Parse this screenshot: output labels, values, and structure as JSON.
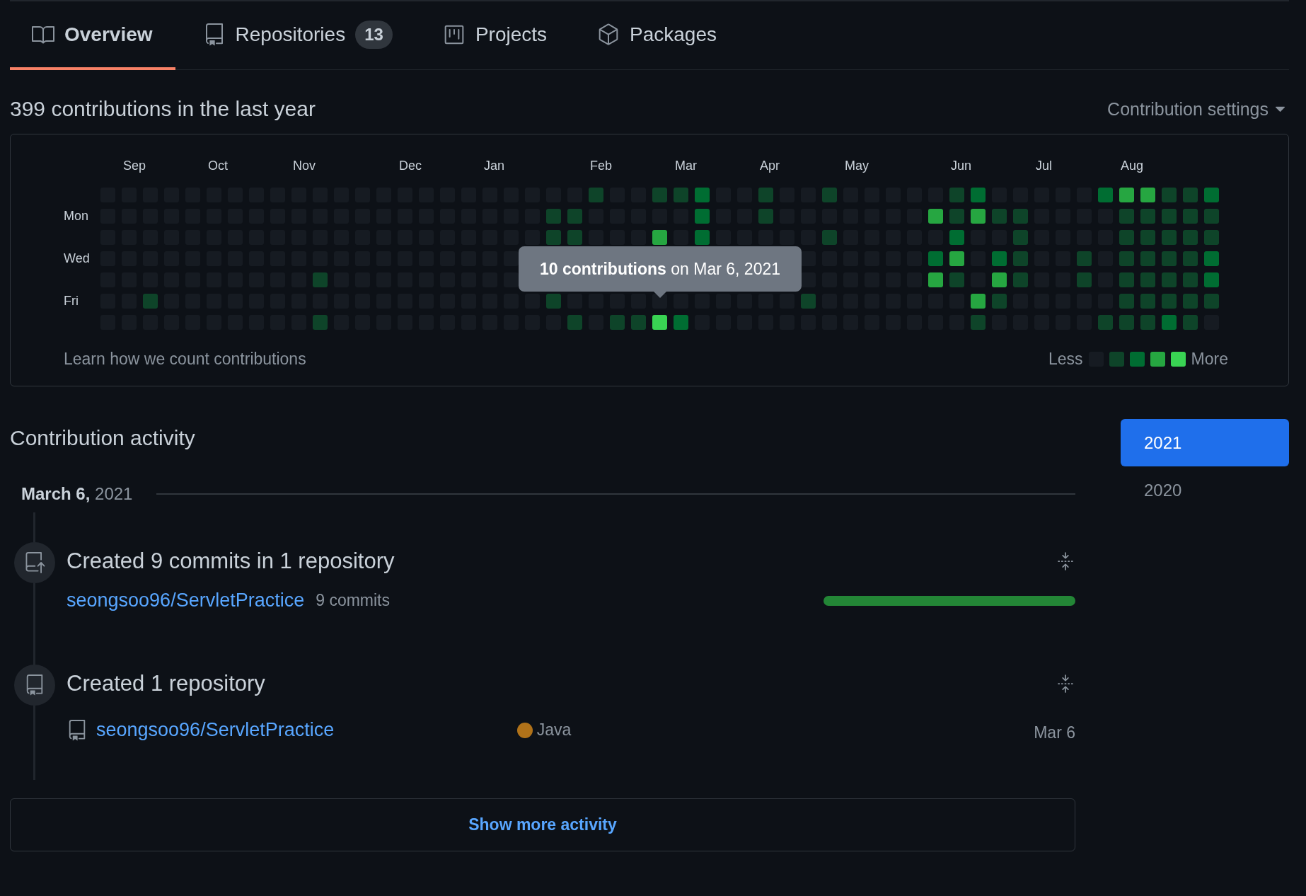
{
  "tabs": [
    {
      "kind": "book",
      "label": "Overview",
      "selected": true
    },
    {
      "kind": "repo",
      "label": "Repositories",
      "counter": "13",
      "selected": false
    },
    {
      "kind": "project",
      "label": "Projects",
      "selected": false
    },
    {
      "kind": "package",
      "label": "Packages",
      "selected": false
    }
  ],
  "graph": {
    "heading": "399 contributions in the last year",
    "settings": "Contribution settings",
    "tooltip": "**10 contributions** on Mar 6, 2021",
    "footer_link": "Learn how we count contributions",
    "legend_less": "Less",
    "legend_more": "More",
    "legend": [
      {
        "color": "#161b22"
      },
      {
        "color": "#0e4429"
      },
      {
        "color": "#006d32"
      },
      {
        "color": "#26a641"
      },
      {
        "color": "#39d353"
      }
    ],
    "rows": [
      {
        "cells": [
          {
            "color": "#161b22"
          },
          {
            "color": "#161b22",
            "month": "Sep"
          },
          {
            "color": "#161b22"
          },
          {
            "color": "#161b22"
          },
          {
            "color": "#161b22"
          },
          {
            "color": "#161b22",
            "month": "Oct"
          },
          {
            "color": "#161b22"
          },
          {
            "color": "#161b22"
          },
          {
            "color": "#161b22"
          },
          {
            "color": "#161b22",
            "month": "Nov"
          },
          {
            "color": "#161b22"
          },
          {
            "color": "#161b22"
          },
          {
            "color": "#161b22"
          },
          {
            "color": "#161b22"
          },
          {
            "color": "#161b22",
            "month": "Dec"
          },
          {
            "color": "#161b22"
          },
          {
            "color": "#161b22"
          },
          {
            "color": "#161b22"
          },
          {
            "color": "#161b22",
            "month": "Jan"
          },
          {
            "color": "#161b22"
          },
          {
            "color": "#161b22"
          },
          {
            "color": "#161b22"
          },
          {
            "color": "#161b22"
          },
          {
            "color": "#0e4429",
            "month": "Feb"
          },
          {
            "color": "#161b22"
          },
          {
            "color": "#161b22"
          },
          {
            "color": "#0e4429"
          },
          {
            "color": "#0e4429",
            "month": "Mar"
          },
          {
            "color": "#006d32"
          },
          {
            "color": "#161b22"
          },
          {
            "color": "#161b22"
          },
          {
            "color": "#0e4429",
            "month": "Apr"
          },
          {
            "color": "#161b22"
          },
          {
            "color": "#161b22"
          },
          {
            "color": "#0e4429"
          },
          {
            "color": "#161b22",
            "month": "May"
          },
          {
            "color": "#161b22"
          },
          {
            "color": "#161b22"
          },
          {
            "color": "#161b22"
          },
          {
            "color": "#161b22"
          },
          {
            "color": "#0e4429",
            "month": "Jun"
          },
          {
            "color": "#006d32"
          },
          {
            "color": "#161b22"
          },
          {
            "color": "#161b22"
          },
          {
            "color": "#161b22",
            "month": "Jul"
          },
          {
            "color": "#161b22"
          },
          {
            "color": "#161b22"
          },
          {
            "color": "#006d32"
          },
          {
            "color": "#26a641",
            "month": "Aug"
          },
          {
            "color": "#26a641"
          },
          {
            "color": "#0e4429"
          },
          {
            "color": "#0e4429"
          },
          {
            "color": "#006d32"
          }
        ]
      },
      {
        "label": "Mon",
        "cells": [
          {
            "color": "#161b22"
          },
          {
            "color": "#161b22"
          },
          {
            "color": "#161b22"
          },
          {
            "color": "#161b22"
          },
          {
            "color": "#161b22"
          },
          {
            "color": "#161b22"
          },
          {
            "color": "#161b22"
          },
          {
            "color": "#161b22"
          },
          {
            "color": "#161b22"
          },
          {
            "color": "#161b22"
          },
          {
            "color": "#161b22"
          },
          {
            "color": "#161b22"
          },
          {
            "color": "#161b22"
          },
          {
            "color": "#161b22"
          },
          {
            "color": "#161b22"
          },
          {
            "color": "#161b22"
          },
          {
            "color": "#161b22"
          },
          {
            "color": "#161b22"
          },
          {
            "color": "#161b22"
          },
          {
            "color": "#161b22"
          },
          {
            "color": "#161b22"
          },
          {
            "color": "#0e4429"
          },
          {
            "color": "#0e4429"
          },
          {
            "color": "#161b22"
          },
          {
            "color": "#161b22"
          },
          {
            "color": "#161b22"
          },
          {
            "color": "#161b22"
          },
          {
            "color": "#161b22"
          },
          {
            "color": "#006d32"
          },
          {
            "color": "#161b22"
          },
          {
            "color": "#161b22"
          },
          {
            "color": "#0e4429"
          },
          {
            "color": "#161b22"
          },
          {
            "color": "#161b22"
          },
          {
            "color": "#161b22"
          },
          {
            "color": "#161b22"
          },
          {
            "color": "#161b22"
          },
          {
            "color": "#161b22"
          },
          {
            "color": "#161b22"
          },
          {
            "color": "#26a641"
          },
          {
            "color": "#0e4429"
          },
          {
            "color": "#26a641"
          },
          {
            "color": "#0e4429"
          },
          {
            "color": "#0e4429"
          },
          {
            "color": "#161b22"
          },
          {
            "color": "#161b22"
          },
          {
            "color": "#161b22"
          },
          {
            "color": "#161b22"
          },
          {
            "color": "#0e4429"
          },
          {
            "color": "#0e4429"
          },
          {
            "color": "#0e4429"
          },
          {
            "color": "#0e4429"
          },
          {
            "color": "#0e4429"
          }
        ]
      },
      {
        "cells": [
          {
            "color": "#161b22"
          },
          {
            "color": "#161b22"
          },
          {
            "color": "#161b22"
          },
          {
            "color": "#161b22"
          },
          {
            "color": "#161b22"
          },
          {
            "color": "#161b22"
          },
          {
            "color": "#161b22"
          },
          {
            "color": "#161b22"
          },
          {
            "color": "#161b22"
          },
          {
            "color": "#161b22"
          },
          {
            "color": "#161b22"
          },
          {
            "color": "#161b22"
          },
          {
            "color": "#161b22"
          },
          {
            "color": "#161b22"
          },
          {
            "color": "#161b22"
          },
          {
            "color": "#161b22"
          },
          {
            "color": "#161b22"
          },
          {
            "color": "#161b22"
          },
          {
            "color": "#161b22"
          },
          {
            "color": "#161b22"
          },
          {
            "color": "#161b22"
          },
          {
            "color": "#0e4429"
          },
          {
            "color": "#0e4429"
          },
          {
            "color": "#161b22"
          },
          {
            "color": "#161b22"
          },
          {
            "color": "#161b22"
          },
          {
            "color": "#26a641"
          },
          {
            "color": "#161b22"
          },
          {
            "color": "#006d32"
          },
          {
            "color": "#161b22"
          },
          {
            "color": "#161b22"
          },
          {
            "color": "#161b22"
          },
          {
            "color": "#161b22"
          },
          {
            "color": "#161b22"
          },
          {
            "color": "#0e4429"
          },
          {
            "color": "#161b22"
          },
          {
            "color": "#161b22"
          },
          {
            "color": "#161b22"
          },
          {
            "color": "#161b22"
          },
          {
            "color": "#161b22"
          },
          {
            "color": "#006d32"
          },
          {
            "color": "#161b22"
          },
          {
            "color": "#161b22"
          },
          {
            "color": "#0e4429"
          },
          {
            "color": "#161b22"
          },
          {
            "color": "#161b22"
          },
          {
            "color": "#161b22"
          },
          {
            "color": "#161b22"
          },
          {
            "color": "#0e4429"
          },
          {
            "color": "#0e4429"
          },
          {
            "color": "#0e4429"
          },
          {
            "color": "#0e4429"
          },
          {
            "color": "#0e4429"
          }
        ]
      },
      {
        "label": "Wed",
        "cells": [
          {
            "color": "#161b22"
          },
          {
            "color": "#161b22"
          },
          {
            "color": "#161b22"
          },
          {
            "color": "#161b22"
          },
          {
            "color": "#161b22"
          },
          {
            "color": "#161b22"
          },
          {
            "color": "#161b22"
          },
          {
            "color": "#161b22"
          },
          {
            "color": "#161b22"
          },
          {
            "color": "#161b22"
          },
          {
            "color": "#161b22"
          },
          {
            "color": "#161b22"
          },
          {
            "color": "#161b22"
          },
          {
            "color": "#161b22"
          },
          {
            "color": "#161b22"
          },
          {
            "color": "#161b22"
          },
          {
            "color": "#161b22"
          },
          {
            "color": "#161b22"
          },
          {
            "color": "#161b22"
          },
          {
            "color": "#161b22"
          },
          {},
          {},
          {},
          {},
          {},
          {},
          {},
          {},
          {},
          {},
          {},
          {},
          {},
          {
            "color": "#161b22"
          },
          {
            "color": "#161b22"
          },
          {
            "color": "#161b22"
          },
          {
            "color": "#161b22"
          },
          {
            "color": "#161b22"
          },
          {
            "color": "#161b22"
          },
          {
            "color": "#006d32"
          },
          {
            "color": "#26a641"
          },
          {
            "color": "#161b22"
          },
          {
            "color": "#006d32"
          },
          {
            "color": "#0e4429"
          },
          {
            "color": "#161b22"
          },
          {
            "color": "#161b22"
          },
          {
            "color": "#0e4429"
          },
          {
            "color": "#161b22"
          },
          {
            "color": "#0e4429"
          },
          {
            "color": "#0e4429"
          },
          {
            "color": "#0e4429"
          },
          {
            "color": "#0e4429"
          },
          {
            "color": "#006d32"
          }
        ]
      },
      {
        "cells": [
          {
            "color": "#161b22"
          },
          {
            "color": "#161b22"
          },
          {
            "color": "#161b22"
          },
          {
            "color": "#161b22"
          },
          {
            "color": "#161b22"
          },
          {
            "color": "#161b22"
          },
          {
            "color": "#161b22"
          },
          {
            "color": "#161b22"
          },
          {
            "color": "#161b22"
          },
          {
            "color": "#161b22"
          },
          {
            "color": "#0e4429"
          },
          {
            "color": "#161b22"
          },
          {
            "color": "#161b22"
          },
          {
            "color": "#161b22"
          },
          {
            "color": "#161b22"
          },
          {
            "color": "#161b22"
          },
          {
            "color": "#161b22"
          },
          {
            "color": "#161b22"
          },
          {
            "color": "#161b22"
          },
          {
            "color": "#161b22"
          },
          {},
          {},
          {},
          {},
          {},
          {},
          {},
          {},
          {},
          {},
          {},
          {},
          {},
          {
            "color": "#161b22"
          },
          {
            "color": "#161b22"
          },
          {
            "color": "#161b22"
          },
          {
            "color": "#161b22"
          },
          {
            "color": "#161b22"
          },
          {
            "color": "#161b22"
          },
          {
            "color": "#26a641"
          },
          {
            "color": "#0e4429"
          },
          {
            "color": "#161b22"
          },
          {
            "color": "#26a641"
          },
          {
            "color": "#0e4429"
          },
          {
            "color": "#161b22"
          },
          {
            "color": "#161b22"
          },
          {
            "color": "#0e4429"
          },
          {
            "color": "#161b22"
          },
          {
            "color": "#0e4429"
          },
          {
            "color": "#0e4429"
          },
          {
            "color": "#0e4429"
          },
          {
            "color": "#0e4429"
          },
          {
            "color": "#006d32"
          }
        ]
      },
      {
        "label": "Fri",
        "cells": [
          {
            "color": "#161b22"
          },
          {
            "color": "#161b22"
          },
          {
            "color": "#0e4429"
          },
          {
            "color": "#161b22"
          },
          {
            "color": "#161b22"
          },
          {
            "color": "#161b22"
          },
          {
            "color": "#161b22"
          },
          {
            "color": "#161b22"
          },
          {
            "color": "#161b22"
          },
          {
            "color": "#161b22"
          },
          {
            "color": "#161b22"
          },
          {
            "color": "#161b22"
          },
          {
            "color": "#161b22"
          },
          {
            "color": "#161b22"
          },
          {
            "color": "#161b22"
          },
          {
            "color": "#161b22"
          },
          {
            "color": "#161b22"
          },
          {
            "color": "#161b22"
          },
          {
            "color": "#161b22"
          },
          {
            "color": "#161b22"
          },
          {
            "color": "#161b22"
          },
          {
            "color": "#0e4429"
          },
          {
            "color": "#161b22"
          },
          {
            "color": "#161b22"
          },
          {
            "color": "#161b22"
          },
          {
            "color": "#161b22"
          },
          {
            "color": "#161b22"
          },
          {
            "color": "#161b22"
          },
          {
            "color": "#161b22"
          },
          {
            "color": "#161b22"
          },
          {
            "color": "#161b22"
          },
          {
            "color": "#161b22"
          },
          {
            "color": "#161b22"
          },
          {
            "color": "#0e4429"
          },
          {
            "color": "#161b22"
          },
          {
            "color": "#161b22"
          },
          {
            "color": "#161b22"
          },
          {
            "color": "#161b22"
          },
          {
            "color": "#161b22"
          },
          {
            "color": "#161b22"
          },
          {
            "color": "#161b22"
          },
          {
            "color": "#26a641"
          },
          {
            "color": "#0e4429"
          },
          {
            "color": "#161b22"
          },
          {
            "color": "#161b22"
          },
          {
            "color": "#161b22"
          },
          {
            "color": "#161b22"
          },
          {
            "color": "#161b22"
          },
          {
            "color": "#0e4429"
          },
          {
            "color": "#0e4429"
          },
          {
            "color": "#0e4429"
          },
          {
            "color": "#0e4429"
          },
          {
            "color": "#0e4429"
          }
        ]
      },
      {
        "cells": [
          {
            "color": "#161b22"
          },
          {
            "color": "#161b22"
          },
          {
            "color": "#161b22"
          },
          {
            "color": "#161b22"
          },
          {
            "color": "#161b22"
          },
          {
            "color": "#161b22"
          },
          {
            "color": "#161b22"
          },
          {
            "color": "#161b22"
          },
          {
            "color": "#161b22"
          },
          {
            "color": "#161b22"
          },
          {
            "color": "#0e4429"
          },
          {
            "color": "#161b22"
          },
          {
            "color": "#161b22"
          },
          {
            "color": "#161b22"
          },
          {
            "color": "#161b22"
          },
          {
            "color": "#161b22"
          },
          {
            "color": "#161b22"
          },
          {
            "color": "#161b22"
          },
          {
            "color": "#161b22"
          },
          {
            "color": "#161b22"
          },
          {
            "color": "#161b22"
          },
          {
            "color": "#161b22"
          },
          {
            "color": "#0e4429"
          },
          {
            "color": "#161b22"
          },
          {
            "color": "#0e4429"
          },
          {
            "color": "#0e4429"
          },
          {
            "color": "#39d353"
          },
          {
            "color": "#006d32"
          },
          {
            "color": "#161b22"
          },
          {
            "color": "#161b22"
          },
          {
            "color": "#161b22"
          },
          {
            "color": "#161b22"
          },
          {
            "color": "#161b22"
          },
          {
            "color": "#161b22"
          },
          {
            "color": "#161b22"
          },
          {
            "color": "#161b22"
          },
          {
            "color": "#161b22"
          },
          {
            "color": "#161b22"
          },
          {
            "color": "#161b22"
          },
          {
            "color": "#161b22"
          },
          {
            "color": "#161b22"
          },
          {
            "color": "#0e4429"
          },
          {
            "color": "#161b22"
          },
          {
            "color": "#161b22"
          },
          {
            "color": "#161b22"
          },
          {
            "color": "#161b22"
          },
          {
            "color": "#161b22"
          },
          {
            "color": "#0e4429"
          },
          {
            "color": "#0e4429"
          },
          {
            "color": "#0e4429"
          },
          {
            "color": "#006d32"
          },
          {
            "color": "#0e4429"
          },
          {
            "color": "#161b22"
          }
        ]
      }
    ]
  },
  "activity": {
    "heading": "Contribution activity",
    "date": "**March 6,** 2021",
    "years": [
      {
        "label": "2021",
        "selected": true
      },
      {
        "label": "2020",
        "selected": false
      }
    ],
    "events": [
      {
        "kind": "commits",
        "title": "Created 9 commits in 1 repository",
        "repos": [
          {
            "name": "seongsoo96/ServletPractice",
            "commits": "9 commits"
          }
        ]
      },
      {
        "kind": "repository",
        "title": "Created 1 repository",
        "repos": [
          {
            "name": "seongsoo96/ServletPractice",
            "language": "Java",
            "color": "#b07219",
            "date": "Mar 6"
          }
        ]
      }
    ],
    "show_more": "Show more activity"
  }
}
